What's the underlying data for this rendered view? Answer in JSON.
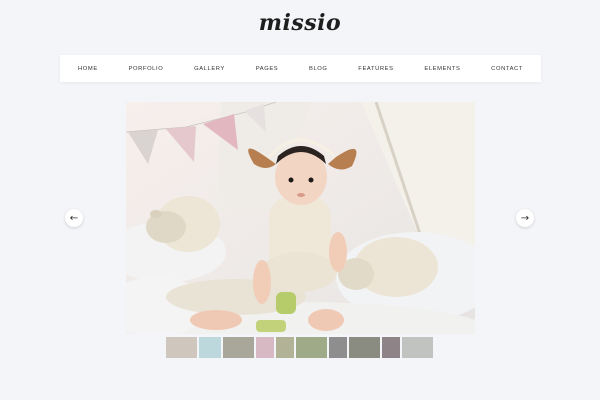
{
  "brand": {
    "logo_text": "missio"
  },
  "nav": {
    "items": [
      "HOME",
      "PORFOLIO",
      "GALLERY",
      "PAGES",
      "BLOG",
      "FEATURES",
      "ELEMENTS",
      "CONTACT"
    ]
  },
  "slider": {
    "prev_icon": "arrow-left-icon",
    "next_icon": "arrow-right-icon",
    "prev_glyph": "←",
    "next_glyph": "→",
    "main_image": "baby-in-sheep-costume-photo",
    "thumbnails": [
      {
        "name": "thumb-1",
        "color": "#cfc6bd"
      },
      {
        "name": "thumb-2",
        "color": "#bcd8dc"
      },
      {
        "name": "thumb-3",
        "color": "#a8a79a"
      },
      {
        "name": "thumb-4",
        "color": "#d7b9c3"
      },
      {
        "name": "thumb-5",
        "color": "#b2b296"
      },
      {
        "name": "thumb-6",
        "color": "#9eaa88"
      },
      {
        "name": "thumb-7",
        "color": "#8e8e8e"
      },
      {
        "name": "thumb-8",
        "color": "#8a8c82"
      },
      {
        "name": "thumb-9",
        "color": "#8e8488"
      },
      {
        "name": "thumb-10",
        "color": "#c1c3c0"
      }
    ]
  }
}
